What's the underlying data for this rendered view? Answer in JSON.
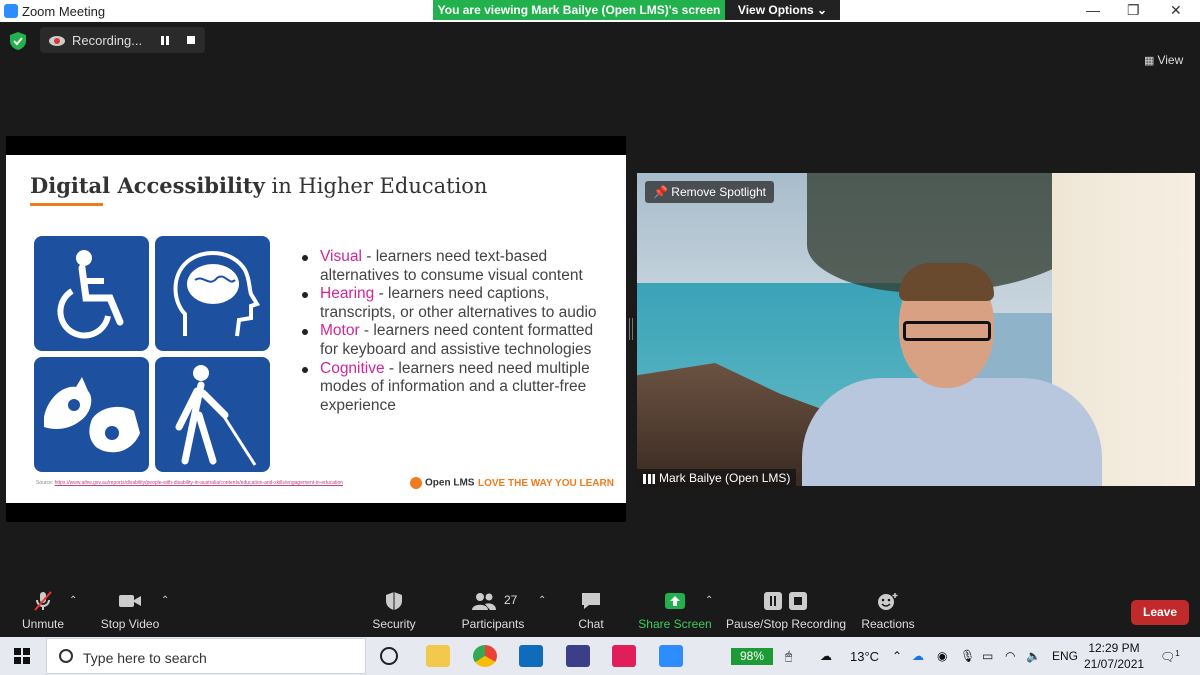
{
  "window": {
    "title": "Zoom Meeting"
  },
  "banner": {
    "viewing": "You are viewing Mark Bailye (Open LMS)'s screen",
    "view_options": "View Options ⌄"
  },
  "window_controls": {
    "minimize": "—",
    "restore": "❐",
    "close": "✕"
  },
  "recording": {
    "label": "Recording..."
  },
  "view": {
    "label": "View"
  },
  "slide": {
    "title_bold": "Digital Accessibility",
    "title_rest": " in Higher Education",
    "bullets": [
      {
        "keyword": "Visual",
        "text": " - learners need text-based alternatives to consume visual content"
      },
      {
        "keyword": "Hearing",
        "text": " - learners need captions, transcripts, or other alternatives to audio"
      },
      {
        "keyword": "Motor",
        "text": " - learners need content formatted for keyboard and assistive technologies"
      },
      {
        "keyword": "Cognitive",
        "text": " - learners need need multiple modes of information and a clutter-free experience"
      }
    ],
    "source_label": "Source: ",
    "source_link": "https://www.aihw.gov.au/reports/disability/people-with-disability-in-australia/contents/education-and-skills/engagement-in-education",
    "brand": "Open LMS",
    "tagline": "LOVE THE WAY YOU LEARN",
    "icons": [
      "wheelchair-icon",
      "brain-head-icon",
      "sign-language-icon",
      "blind-cane-icon"
    ]
  },
  "video": {
    "spotlight_label": "Remove Spotlight",
    "participant_name": "Mark Bailye (Open LMS)"
  },
  "toolbar": {
    "unmute": "Unmute",
    "stop_video": "Stop Video",
    "security": "Security",
    "participants": "Participants",
    "participants_count": "27",
    "chat": "Chat",
    "share_screen": "Share Screen",
    "pause_stop_recording": "Pause/Stop Recording",
    "reactions": "Reactions",
    "leave": "Leave"
  },
  "taskbar": {
    "search_placeholder": "Type here to search",
    "battery": "98%",
    "temperature": "13°C",
    "language": "ENG",
    "time": "12:29 PM",
    "date": "21/07/2021",
    "notification_count": "1"
  },
  "colors": {
    "accent_green": "#22b14c",
    "leave_red": "#c12a2a",
    "slide_keyword": "#d0269a",
    "slide_orange": "#f07b1e",
    "icon_blue": "#1e50a0"
  }
}
